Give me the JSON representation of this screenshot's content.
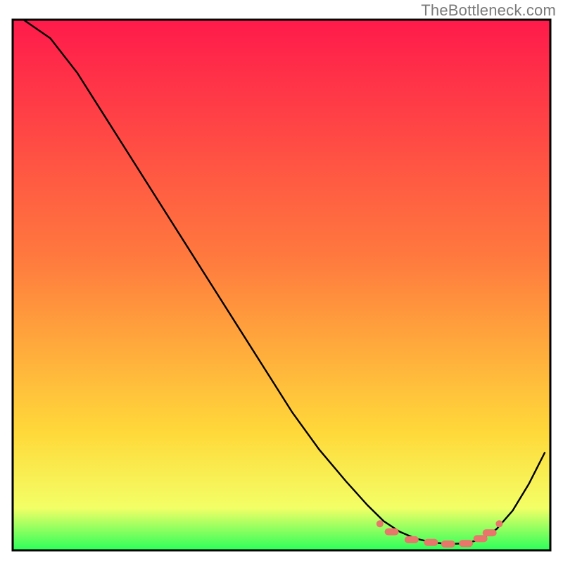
{
  "attribution": "TheBottleneck.com",
  "colors": {
    "gradient_top": "#ff1a4b",
    "gradient_mid1": "#ff7a3e",
    "gradient_mid2": "#ffd93a",
    "gradient_bottom": "#2bff5a",
    "curve": "#000000",
    "marker": "#e8766a"
  },
  "chart_data": {
    "type": "line",
    "title": "",
    "xlabel": "",
    "ylabel": "",
    "xlim": [
      0,
      1
    ],
    "ylim": [
      0,
      1
    ],
    "grid": false,
    "legend": false,
    "series": [
      {
        "name": "bottleneck-curve",
        "x": [
          0.02,
          0.07,
          0.12,
          0.17,
          0.22,
          0.27,
          0.32,
          0.37,
          0.42,
          0.47,
          0.52,
          0.57,
          0.62,
          0.66,
          0.69,
          0.72,
          0.75,
          0.78,
          0.81,
          0.84,
          0.87,
          0.9,
          0.93,
          0.96,
          0.99
        ],
        "y": [
          1.0,
          0.965,
          0.9,
          0.82,
          0.74,
          0.66,
          0.58,
          0.5,
          0.42,
          0.34,
          0.26,
          0.19,
          0.13,
          0.085,
          0.055,
          0.035,
          0.022,
          0.015,
          0.012,
          0.013,
          0.02,
          0.04,
          0.075,
          0.125,
          0.185
        ]
      }
    ],
    "markers": {
      "name": "optimal-band",
      "x": [
        0.683,
        0.705,
        0.742,
        0.778,
        0.81,
        0.843,
        0.87,
        0.887,
        0.905
      ],
      "y": [
        0.05,
        0.035,
        0.02,
        0.015,
        0.012,
        0.013,
        0.022,
        0.033,
        0.05
      ]
    },
    "annotations": []
  }
}
